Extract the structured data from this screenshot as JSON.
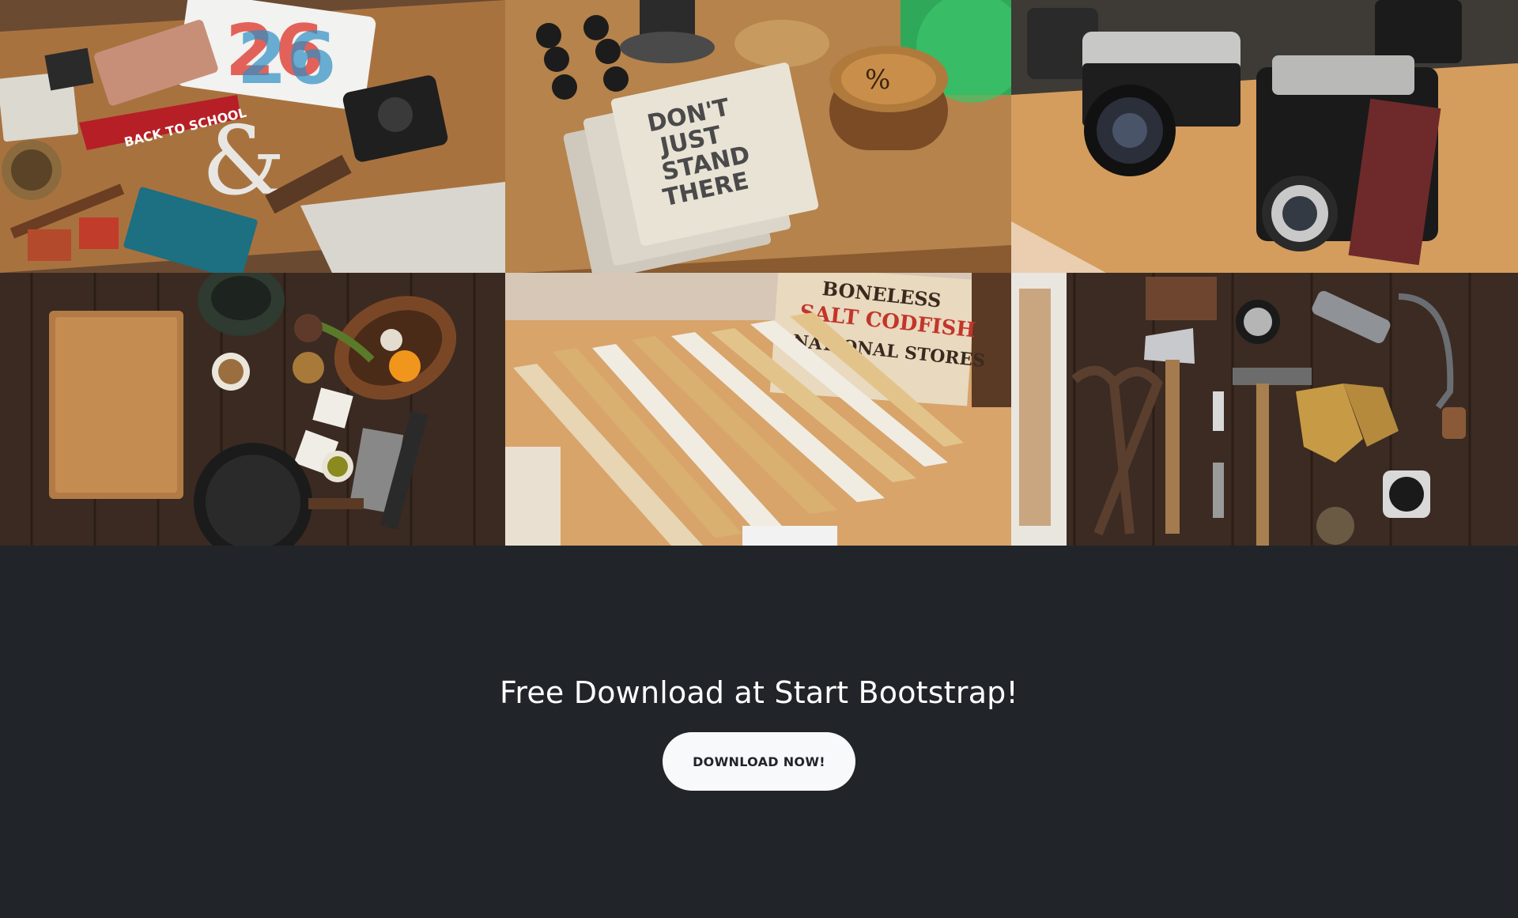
{
  "gallery": {
    "tiles": [
      {
        "name": "photo-desk-items"
      },
      {
        "name": "photo-notebooks"
      },
      {
        "name": "photo-cameras"
      },
      {
        "name": "photo-kitchen"
      },
      {
        "name": "photo-rulers"
      },
      {
        "name": "photo-tools"
      }
    ],
    "notebook_text": [
      "DON'T",
      "JUST",
      "STAND",
      "THERE"
    ],
    "pennant_text": "BACK TO SCHOOL",
    "sign_text": [
      "BONELESS",
      "SALT CODFISH",
      "NATIONAL STORES"
    ]
  },
  "cta": {
    "heading": "Free Download at Start Bootstrap!",
    "button_label": "DOWNLOAD NOW!"
  },
  "colors": {
    "background": "#212529",
    "button_bg": "#f8f9fa",
    "wood_light": "#b07a45",
    "wood_dark": "#3a2a20"
  }
}
